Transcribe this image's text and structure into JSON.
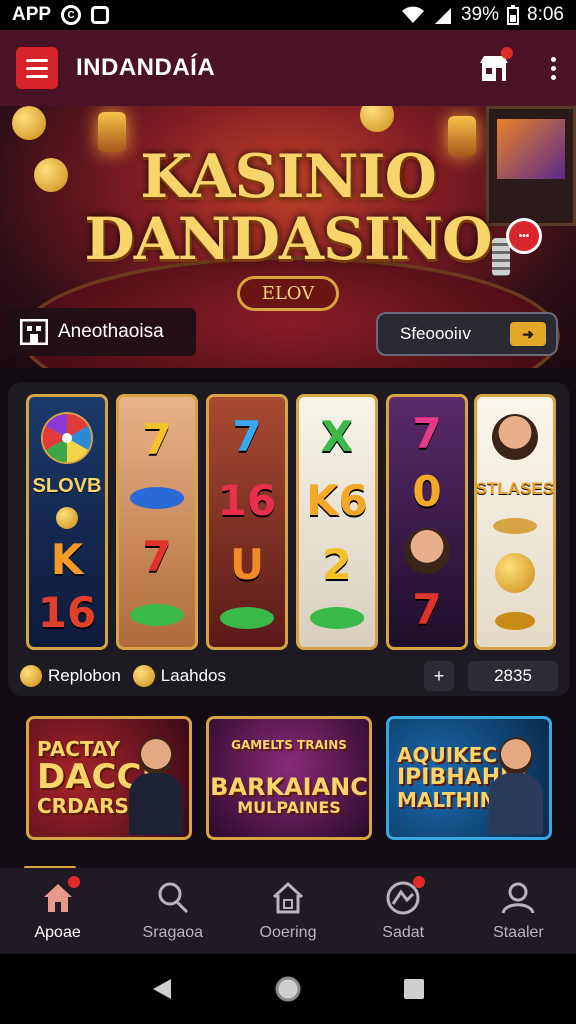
{
  "status_bar": {
    "app_label": "APP",
    "battery_pct": "39%",
    "time": "8:06"
  },
  "app_bar": {
    "title": "INDANDAÍA"
  },
  "banner": {
    "logo_line1": "KASINIO",
    "logo_line2": "DANDASINO",
    "plaque": "ELOV",
    "chip_badge": "•••",
    "left_pill_label": "Aneothaoisa",
    "right_pill_label": "Sfeoooiıv",
    "right_pill_tag": "➜"
  },
  "reels": [
    {
      "bg": "#12284a",
      "symbols": [
        "wheel",
        "SLOVB",
        "coin",
        "K",
        "16"
      ]
    },
    {
      "bg": "#c98a5a",
      "symbols": [
        "7",
        "oval-blue",
        "7",
        "oval-green"
      ]
    },
    {
      "bg": "#7a2a22",
      "symbols": [
        "7",
        "16",
        "U",
        "oval-green"
      ]
    },
    {
      "bg": "#f1ece2",
      "symbols": [
        "X",
        "K6",
        "2",
        "oval-green"
      ]
    },
    {
      "bg": "#3a1a4a",
      "symbols": [
        "7",
        "0",
        "face",
        "7"
      ]
    },
    {
      "bg": "#f3eee2",
      "symbols": [
        "face",
        "STLASES",
        "bar",
        "sun",
        "oval-gold"
      ]
    }
  ],
  "reel_footer": {
    "left1": "Replobon",
    "left2": "Laahdos",
    "plus": "+",
    "total": "2835"
  },
  "promos": [
    {
      "line1": "PACTAY",
      "line2": "DACCK",
      "line3": "CRDARS"
    },
    {
      "line0": "GAMELTS TRAINS",
      "line1": "BARKAIANC",
      "line2": "MULPAINES"
    },
    {
      "line1": "AQUIKEC",
      "line2": "IPIBHAHIN",
      "line3": "MALTHINS"
    }
  ],
  "bottom_nav": [
    {
      "label": "Apoae",
      "icon": "home-icon",
      "badge": true,
      "active": true
    },
    {
      "label": "Sragaoa",
      "icon": "search-icon",
      "badge": false,
      "active": false
    },
    {
      "label": "Ooering",
      "icon": "house-outline-icon",
      "badge": false,
      "active": false
    },
    {
      "label": "Sadat",
      "icon": "wheel-icon",
      "badge": true,
      "active": false
    },
    {
      "label": "Staaler",
      "icon": "profile-icon",
      "badge": false,
      "active": false
    }
  ],
  "colors": {
    "accent_red": "#d9232b",
    "gold": "#d6a443",
    "app_bar": "#4a1226",
    "panel": "#1e1a22"
  }
}
